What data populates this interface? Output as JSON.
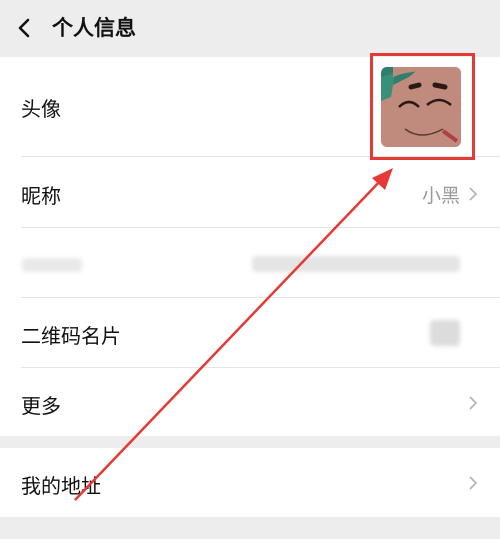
{
  "header": {
    "title": "个人信息",
    "back_icon": "chevron-left-icon"
  },
  "profile": {
    "avatar_label": "头像",
    "nickname_label": "昵称",
    "nickname_value": "小黑",
    "qr_label": "二维码名片",
    "more_label": "更多"
  },
  "address": {
    "label": "我的地址"
  },
  "colors": {
    "annotation": "#e53935",
    "background": "#ededed",
    "row_bg": "#ffffff"
  }
}
